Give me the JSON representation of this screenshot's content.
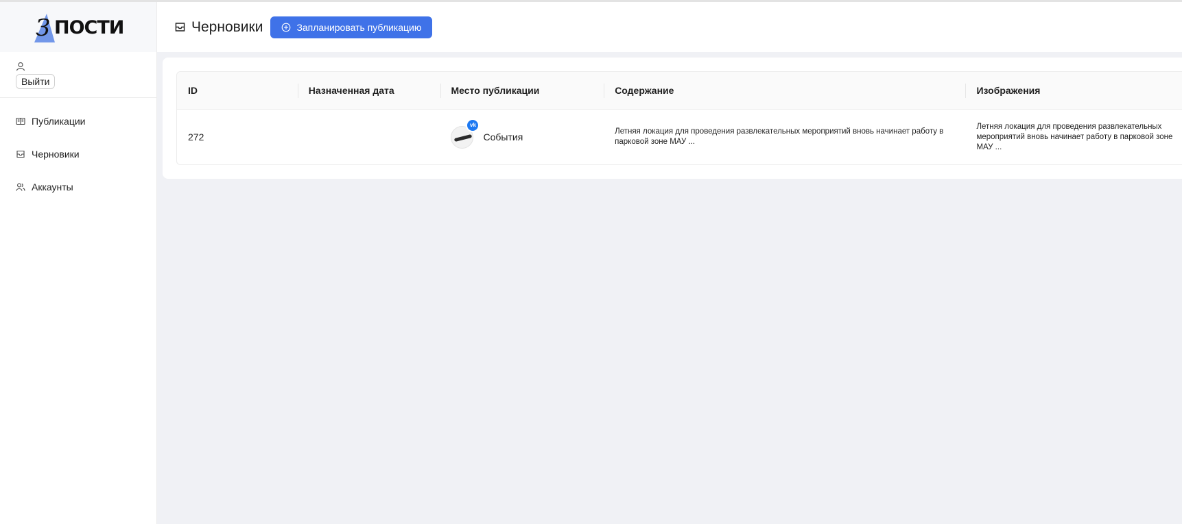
{
  "brand": {
    "logo_text": "ПОСТИ",
    "logo_script": "З"
  },
  "user": {
    "logout_label": "Выйти"
  },
  "sidebar": {
    "items": [
      {
        "label": "Публикации",
        "icon": "newspaper-icon"
      },
      {
        "label": "Черновики",
        "icon": "inbox-icon"
      },
      {
        "label": "Аккаунты",
        "icon": "users-icon"
      }
    ]
  },
  "header": {
    "title": "Черновики",
    "title_icon": "inbox-icon",
    "schedule_label": "Запланировать публикацию",
    "schedule_icon": "plus-circle-icon"
  },
  "table": {
    "columns": [
      "ID",
      "Назначенная дата",
      "Место публикации",
      "Содержание",
      "Изображения"
    ],
    "rows": [
      {
        "id": "272",
        "date": "",
        "place": "События",
        "place_badge": "vk",
        "content": "Летняя локация для проведения развлекательных мероприятий вновь начинает работу в парковой зоне МАУ ...",
        "images": "Летняя локация для проведения развлекательных мероприятий вновь начинает работу в парковой зоне МАУ ..."
      }
    ]
  },
  "colors": {
    "accent": "#3f72e8",
    "vk": "#1d79f2",
    "background": "#f0f1f5"
  }
}
